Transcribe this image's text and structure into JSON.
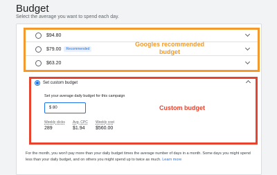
{
  "page": {
    "title": "Budget",
    "subtitle": "Select the average you want to spend each day."
  },
  "options": [
    {
      "amount": "$94.80",
      "badge": ""
    },
    {
      "amount": "$79.00",
      "badge": "Recommended"
    },
    {
      "amount": "$63.20",
      "badge": ""
    }
  ],
  "annotations": {
    "recommended_line1": "Googles recommended",
    "recommended_line2": "budget",
    "custom": "Custom budget"
  },
  "custom": {
    "label": "Set custom budget",
    "instruction": "Set your average daily budget for this campaign",
    "input_value": "$ 80",
    "stats": [
      {
        "label": "Weekly clicks",
        "value": "289"
      },
      {
        "label": "Avg. CPC",
        "value": "$1.94"
      },
      {
        "label": "Weekly cost",
        "value": "$560.00"
      }
    ]
  },
  "footer": {
    "text": "For the month, you won't pay more than your daily budget times the average number of days in a month. Some days you might spend less than your daily budget, and on others you might spend up to twice as much.",
    "link": "Learn more"
  },
  "colors": {
    "accent": "#1a73e8",
    "recommended_annotation": "#f29a2e",
    "custom_annotation": "#e8432e"
  }
}
